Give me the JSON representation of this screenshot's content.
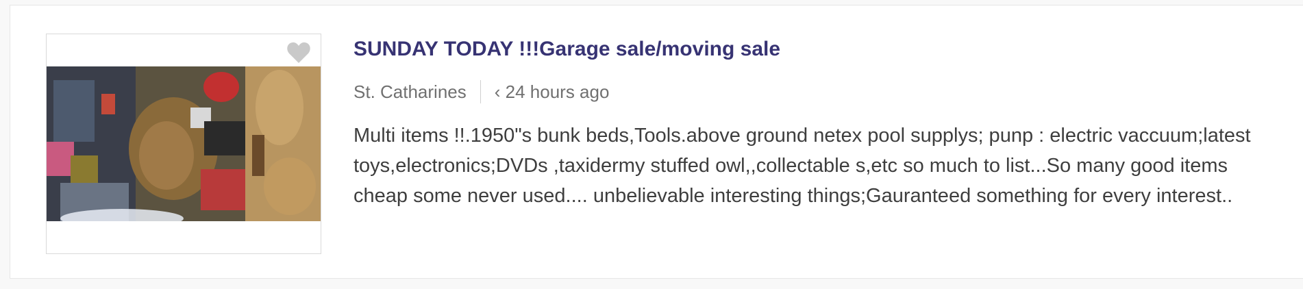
{
  "listing": {
    "title": "SUNDAY TODAY !!!Garage sale/moving sale",
    "location": "St. Catharines",
    "posted": "‹ 24 hours ago",
    "description": "Multi items !!.1950\"s bunk beds,Tools.above ground netex pool supplys; punp : electric vaccuum;latest toys,electronics;DVDs ,taxidermy stuffed owl,,collectable s,etc so much to list...So many good items cheap some never used.... unbelievable interesting things;Gauranteed something for every interest..",
    "favorite_icon": "heart-icon",
    "colors": {
      "title": "#373373",
      "meta": "#707070",
      "text": "#3e3e3e",
      "heart": "#c9c9c9"
    }
  }
}
